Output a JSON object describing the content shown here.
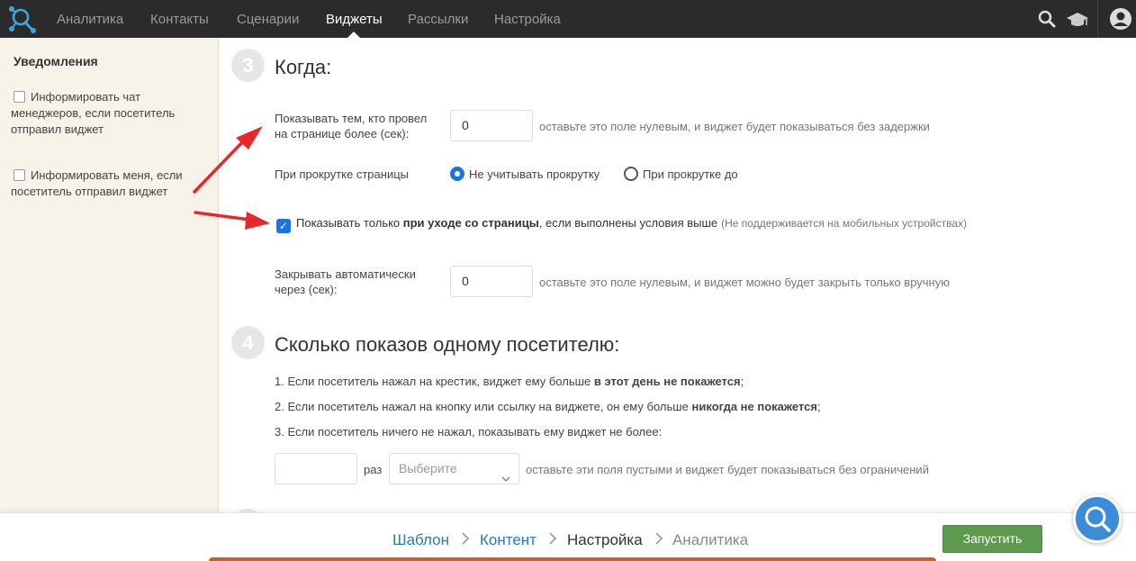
{
  "nav": {
    "items": [
      "Аналитика",
      "Контакты",
      "Сценарии",
      "Виджеты",
      "Рассылки",
      "Настройка"
    ],
    "active": "Виджеты",
    "icons": [
      "search-icon",
      "graduation-cap-icon",
      "user-avatar-icon"
    ]
  },
  "sidebar": {
    "title": "Уведомления",
    "checks": [
      "Информировать чат менеджеров, если посетитель отправил виджет",
      "Информировать меня, если посетитель отправил виджет"
    ]
  },
  "step3": {
    "number": "3",
    "title": "Когда:",
    "delay_label": "Показывать тем, кто провел на странице более (сек):",
    "delay_value": "0",
    "delay_hint": "оставьте это поле нулевым, и виджет будет показываться без задержки",
    "scroll_label": "При прокрутке страницы",
    "scroll_option_1": "Не учитывать прокрутку",
    "scroll_option_2": "При прокрутке до",
    "exit_prefix": "Показывать только ",
    "exit_bold": "при уходе со страницы",
    "exit_suffix": ", если выполнены условия выше",
    "exit_note": "(Не поддерживается на мобильных устройствах)",
    "autoclose_label": "Закрывать автоматически через (сек):",
    "autoclose_value": "0",
    "autoclose_hint": "оставьте это поле нулевым, и виджет можно будет закрыть только вручную"
  },
  "step4": {
    "number": "4",
    "title": "Сколько показов одному посетителю:",
    "rule1_text": "1. Если посетитель нажал на крестик, виджет ему больше ",
    "rule1_bold": "в этот день не покажется",
    "rule1_end": ";",
    "rule2_text": "2. Если посетитель нажал на кнопку или ссылку на виджете, он ему больше ",
    "rule2_bold": "никогда не покажется",
    "rule2_end": ";",
    "rule3_text": "3. Если посетитель ничего не нажал, показывать ему виджет не более:",
    "times_value": "",
    "times_label": "раз",
    "period_placeholder": "Выберите",
    "limit_hint": "оставьте эти поля пустыми и виджет будет показываться без ограничений"
  },
  "footer": {
    "crumbs": [
      "Шаблон",
      "Контент",
      "Настройка",
      "Аналитика"
    ],
    "launch_label": "Запустить"
  },
  "colors": {
    "nav_bg": "#2b2b2b",
    "sidebar_bg": "#f7f3e8",
    "accent": "#1a73e8",
    "link": "#2a7ab5",
    "launch": "#5e9a4d",
    "arrow": "#e8272b",
    "help": "#3a8dd6"
  }
}
